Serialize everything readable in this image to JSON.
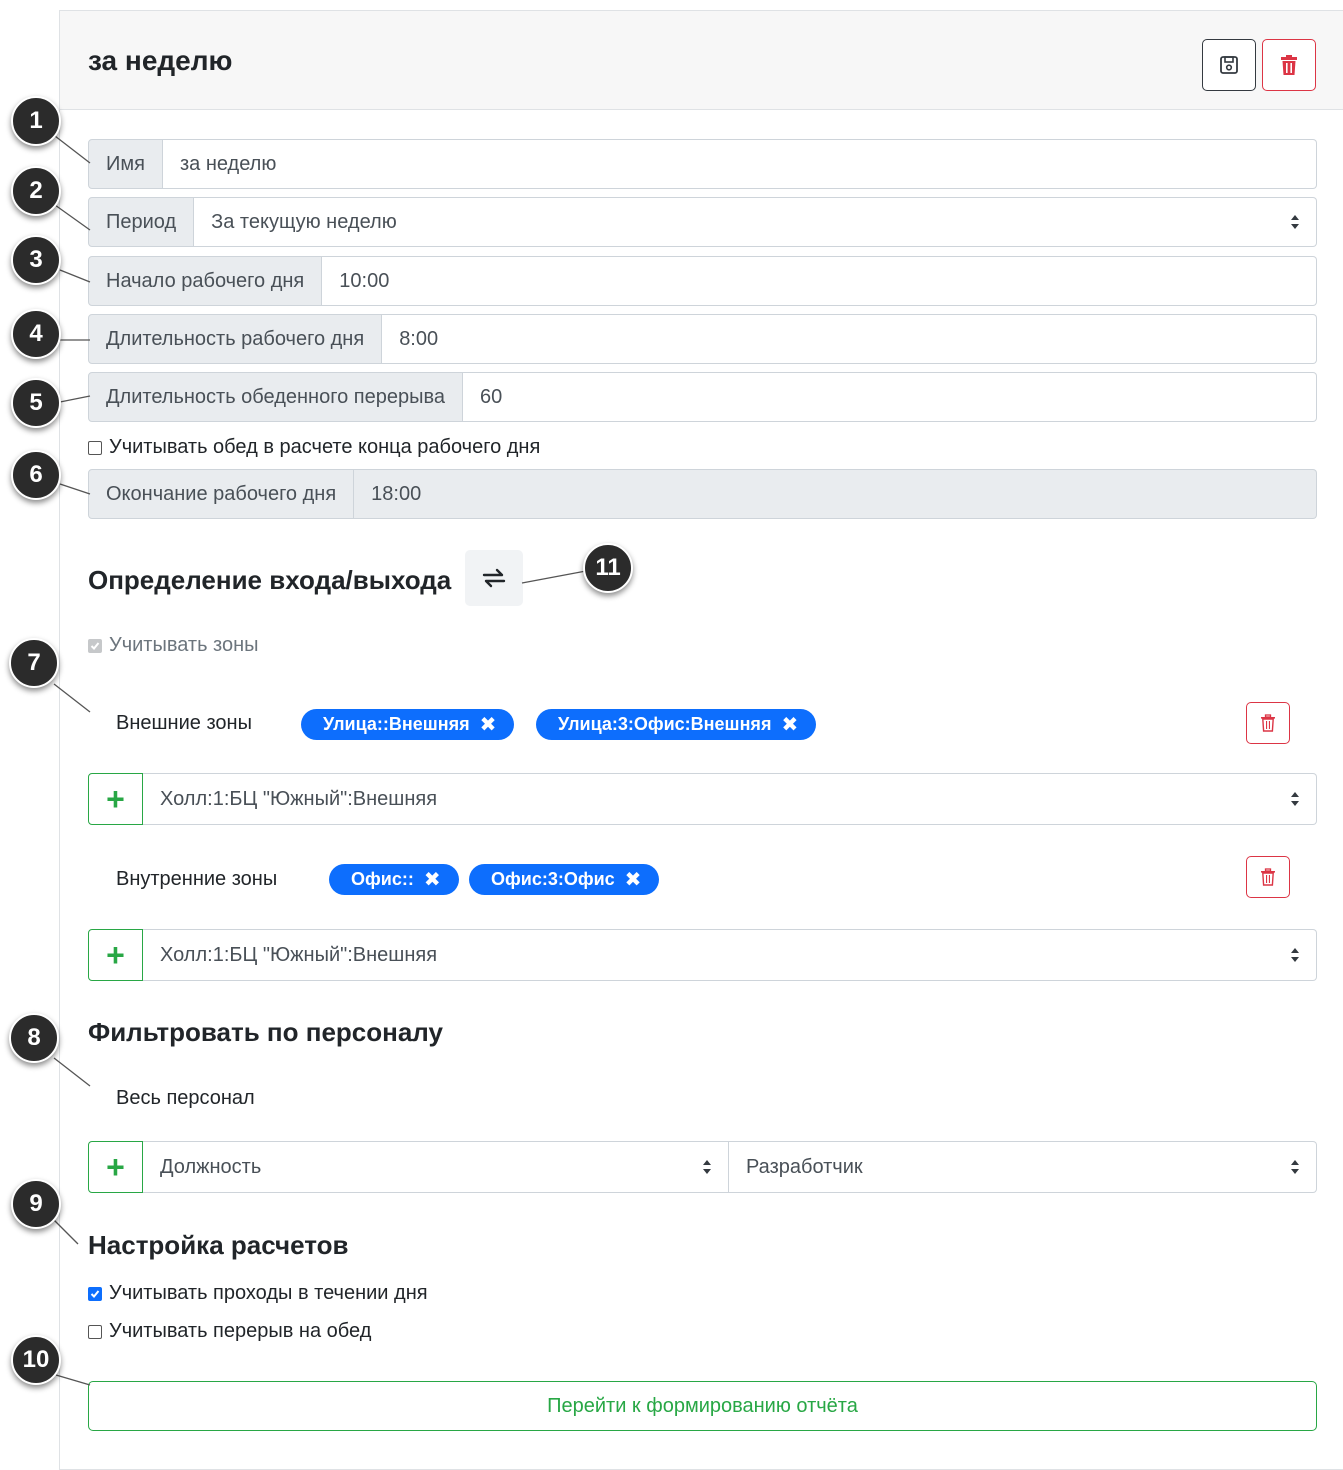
{
  "header": {
    "title": "за неделю",
    "save_icon": "floppy-disk-icon",
    "delete_icon": "trash-icon"
  },
  "fields": {
    "name_label": "Имя",
    "name_value": "за неделю",
    "period_label": "Период",
    "period_value": "За текущую неделю",
    "day_start_label": "Начало рабочего дня",
    "day_start_value": "10:00",
    "day_length_label": "Длительность рабочего дня",
    "day_length_value": "8:00",
    "lunch_length_label": "Длительность обеденного перерыва",
    "lunch_length_value": "60",
    "lunch_in_end_checkbox": "Учитывать обед в расчете конца рабочего дня",
    "day_end_label": "Окончание рабочего дня",
    "day_end_value": "18:00"
  },
  "entry_exit": {
    "title": "Определение входа/выхода",
    "swap_icon": "swap-arrows-icon",
    "use_zones_checkbox": "Учитывать зоны",
    "external_label": "Внешние зоны",
    "external_tags": [
      "Улица::Внешняя",
      "Улица:3:Офис:Внешняя"
    ],
    "external_select": "Холл:1:БЦ \"Южный\":Внешняя",
    "internal_label": "Внутренние зоны",
    "internal_tags": [
      "Офис::",
      "Офис:3:Офис"
    ],
    "internal_select": "Холл:1:БЦ \"Южный\":Внешняя"
  },
  "staff_filter": {
    "title": "Фильтровать по персоналу",
    "summary": "Весь персонал",
    "field_select": "Должность",
    "value_select": "Разработчик"
  },
  "calc_settings": {
    "title": "Настройка расчетов",
    "passes_checkbox": "Учитывать проходы в течении дня",
    "passes_checked": true,
    "lunch_checkbox": "Учитывать перерыв на обед",
    "lunch_checked": false
  },
  "report_button": "Перейти к формированию отчёта",
  "callouts": [
    "1",
    "2",
    "3",
    "4",
    "5",
    "6",
    "7",
    "8",
    "9",
    "10",
    "11"
  ],
  "colors": {
    "primary": "#0d6efd",
    "danger": "#dc3545",
    "success": "#28a745",
    "callout": "#2b2b2b"
  }
}
